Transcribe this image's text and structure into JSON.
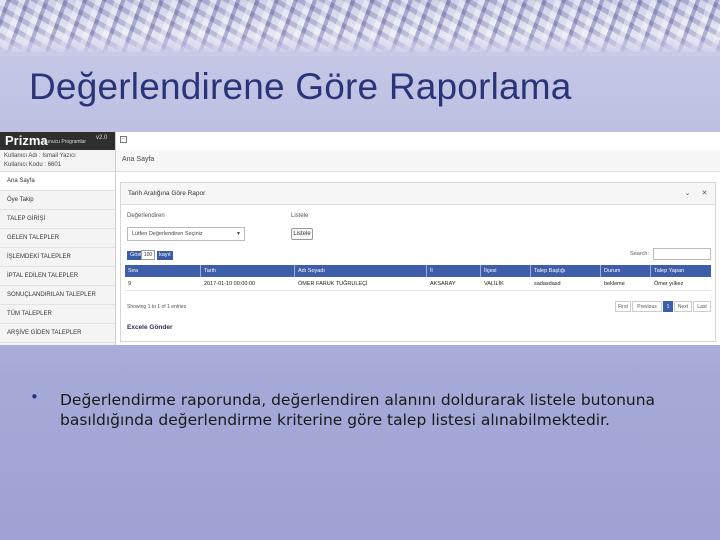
{
  "slide": {
    "title": "Değerlendirene Göre Raporlama",
    "bullet": "Değerlendirme raporunda, değerlendiren alanını doldurarak listele butonuna basıldığında değerlendirme kriterine göre talep listesi alınabilmektedir."
  },
  "app": {
    "brand": "Prizma",
    "brand_sub": "Sunucu Programlar",
    "version": "v2.0",
    "user_line1": "Kullanıcı Adı : Ismail Yazıcı",
    "user_line2": "Kullanıcı Kodu : 6601",
    "breadcrumb": "Ana Sayfa"
  },
  "sidebar": {
    "items": [
      {
        "label": "Ana Sayfa"
      },
      {
        "label": "Öye Takip"
      },
      {
        "label": "TALEP GİRİŞİ"
      },
      {
        "label": "GELEN TALEPLER"
      },
      {
        "label": "İŞLEMDEKİ TALEPLER"
      },
      {
        "label": "İPTAL EDİLEN TALEPLER"
      },
      {
        "label": "SONUÇLANDIRILAN TALEPLER"
      },
      {
        "label": "TÜM TALEPLER"
      },
      {
        "label": "ARŞİVE GİDEN TALEPLER"
      }
    ]
  },
  "panel": {
    "title": "Tarih Aralığına Göre Rapor",
    "chevron": "⌄",
    "close": "✕",
    "field1_label": "Değerlendiren",
    "field1_value": "Lütfen Değerlendiren Seçiniz",
    "field2_label": "Listele",
    "listele_btn": "Listele",
    "search_label": "Search:",
    "length_prefix": "Göster",
    "length_value": "100",
    "length_suffix": "kayıt",
    "columns": [
      "Sıra",
      "Tarih",
      "Adı Soyadı",
      "İl",
      "İlçesi",
      "Talep Başlığı",
      "Durum",
      "Talep Yapan"
    ],
    "rows": [
      [
        "9",
        "2017-01-10 00:00:00",
        "ÖMER FARUK TUĞRULEÇİ",
        "AKSARAY",
        "VALİLİK",
        "sadasdasd",
        "bekleme",
        "Ömer yılkez"
      ]
    ],
    "showing": "Showing 1 to 1 of 1 entries",
    "pager": {
      "first": "First",
      "prev": "Previous",
      "current": "1",
      "next": "Next",
      "last": "Last"
    },
    "excel_button": "Excele Gönder"
  },
  "colors": {
    "title": "#2a3579",
    "table_header": "#3e5ea9",
    "background": "#b9bce0"
  }
}
